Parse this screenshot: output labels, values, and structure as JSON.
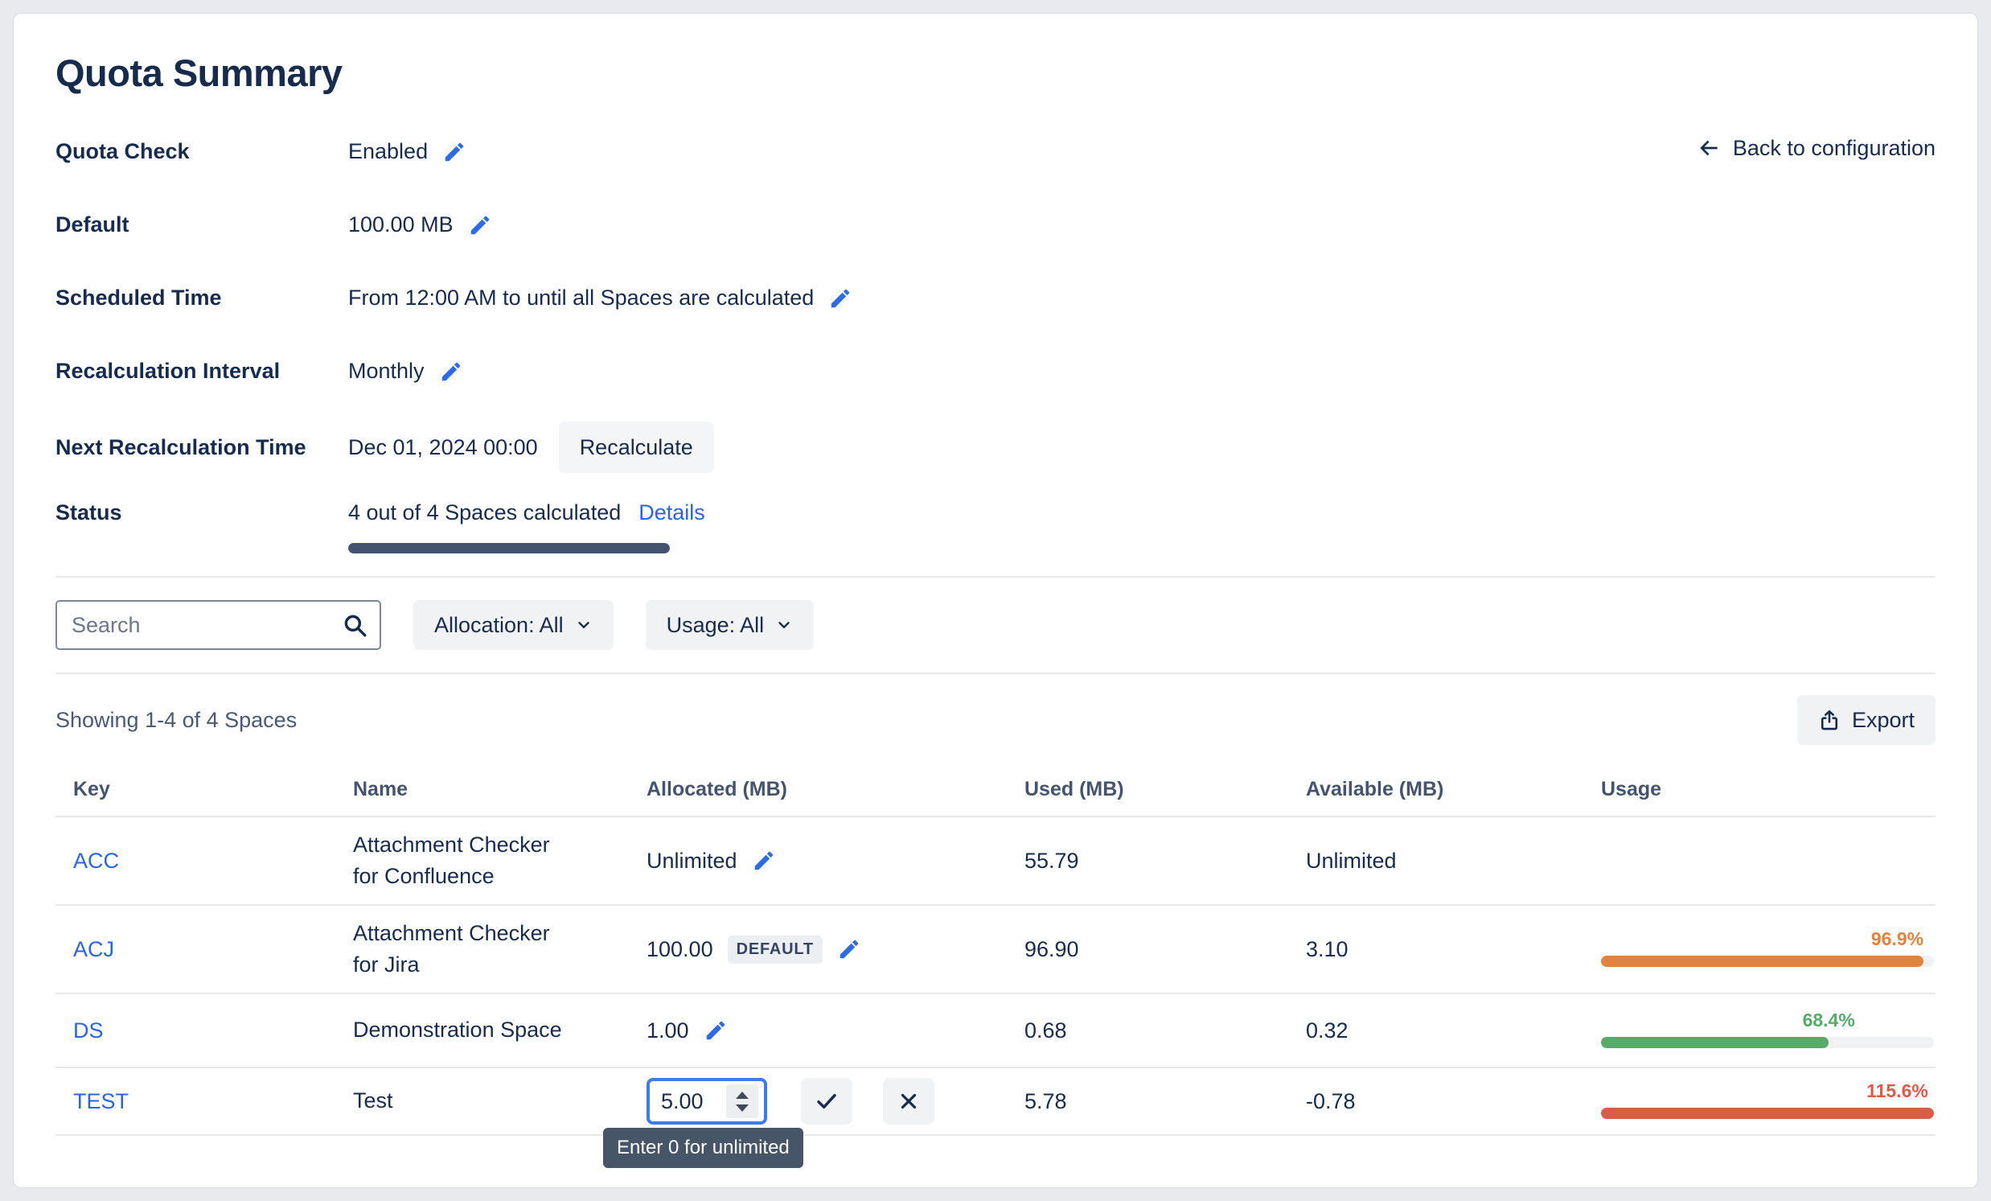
{
  "page": {
    "title": "Quota Summary"
  },
  "header": {
    "back_label": "Back to configuration"
  },
  "summary": {
    "quota_check": {
      "label": "Quota Check",
      "value": "Enabled"
    },
    "default_quota": {
      "label": "Default",
      "value": "100.00 MB"
    },
    "scheduled_time": {
      "label": "Scheduled Time",
      "value": "From 12:00 AM to until all Spaces are calculated"
    },
    "recalculation_interval": {
      "label": "Recalculation Interval",
      "value": "Monthly"
    },
    "next_recalculation": {
      "label": "Next Recalculation Time",
      "value": "Dec 01, 2024 00:00",
      "button_label": "Recalculate"
    },
    "status": {
      "label": "Status",
      "value": "4 out of 4 Spaces calculated",
      "link_label": "Details",
      "progress_percent": 100,
      "bar_color": "#44546F"
    }
  },
  "filters": {
    "search_placeholder": "Search",
    "allocation_filter_label": "Allocation: All",
    "usage_filter_label": "Usage: All"
  },
  "list": {
    "showing_text": "Showing 1-4 of 4 Spaces",
    "export_label": "Export"
  },
  "table": {
    "headers": {
      "key": "Key",
      "name": "Name",
      "allocated": "Allocated (MB)",
      "used": "Used (MB)",
      "available": "Available (MB)",
      "usage": "Usage"
    },
    "rows": [
      {
        "key": "ACC",
        "name": "Attachment Checker for Confluence",
        "allocated": "Unlimited",
        "used": "55.79",
        "available": "Unlimited"
      },
      {
        "key": "ACJ",
        "name": "Attachment Checker for Jira",
        "allocated": "100.00",
        "allocated_badge": "DEFAULT",
        "used": "96.90",
        "available": "3.10",
        "usage_percent_label": "96.9%",
        "usage_fill_percent": 96.9,
        "usage_label_left": 89,
        "usage_color": "#E2823E"
      },
      {
        "key": "DS",
        "name": "Demonstration Space",
        "allocated": "1.00",
        "used": "0.68",
        "available": "0.32",
        "usage_percent_label": "68.4%",
        "usage_fill_percent": 68.4,
        "usage_label_left": 68.4,
        "usage_color": "#57AB68"
      },
      {
        "key": "TEST",
        "name": "Test",
        "allocated_input_value": "5.00",
        "allocated_tooltip": "Enter 0 for unlimited",
        "used": "5.78",
        "available": "-0.78",
        "usage_percent_label": "115.6%",
        "usage_fill_percent": 100,
        "usage_label_left": 89,
        "usage_color": "#DB5A4A"
      }
    ]
  }
}
